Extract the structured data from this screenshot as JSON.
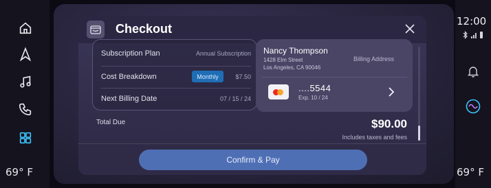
{
  "left_rail": {
    "temperature": "69° F",
    "icons": [
      "home-icon",
      "navigation-icon",
      "music-icon",
      "phone-icon",
      "apps-grid-icon"
    ]
  },
  "right_rail": {
    "clock": "12:00",
    "temperature": "69° F",
    "icons": [
      "bluetooth-icon",
      "signal-icon",
      "battery-icon",
      "bell-icon",
      "assistant-icon"
    ]
  },
  "modal": {
    "title": "Checkout",
    "app_icon": "wallet-icon",
    "close_icon": "close-icon",
    "subscription": {
      "plan_label": "Subscription Plan",
      "plan_value": "Annual Subscription",
      "cost_label": "Cost Breakdown",
      "cost_toggle": "Monthly",
      "cost_value": "$7.50",
      "next_billing_label": "Next Billing Date",
      "next_billing_value": "07 / 15 / 24"
    },
    "billing": {
      "name": "Nancy Thompson",
      "street": "1428 Elm Street",
      "city": "Los Angeles, CA 90046",
      "address_label": "Billing Address",
      "card_masked": "....5544",
      "card_expiry": "Exp. 10 / 24",
      "card_icon": "mastercard-icon"
    },
    "total": {
      "label": "Total Due",
      "amount": "$90.00",
      "note": "Includes taxes and fees"
    },
    "confirm_label": "Confirm & Pay"
  },
  "colors": {
    "accent": "#1e6db5",
    "button": "#4f6fb5",
    "modal_bg": "#3b3657"
  }
}
